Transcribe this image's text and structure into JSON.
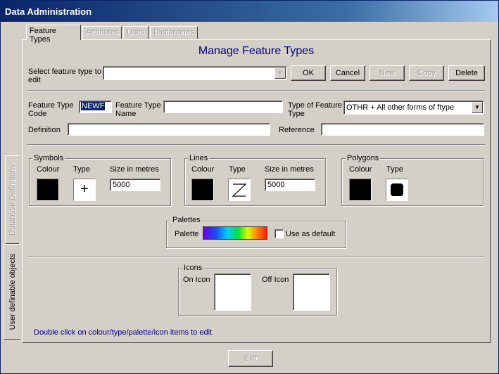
{
  "window": {
    "title": "Data Administration"
  },
  "tabs": [
    {
      "label": "Feature Types",
      "active": true
    },
    {
      "label": "Attributes",
      "active": false
    },
    {
      "label": "Units",
      "active": false
    },
    {
      "label": "Dictionaries",
      "active": false
    }
  ],
  "side_tabs": [
    {
      "label": "Database Definitions",
      "active": false
    },
    {
      "label": "User definable objects",
      "active": true
    }
  ],
  "heading": "Manage Feature Types",
  "select": {
    "label": "Select feature type to edit",
    "value": ""
  },
  "buttons": {
    "ok": "OK",
    "cancel": "Cancel",
    "new": "New",
    "copy": "Copy",
    "delete": "Delete",
    "exit": "Exit"
  },
  "form": {
    "code_label": "Feature Type Code",
    "code_value": "NEWF",
    "name_label": "Feature Type Name",
    "name_value": "",
    "type_label": "Type of Feature Type",
    "type_value": "OTHR + All other forms of ftype",
    "definition_label": "Definition",
    "definition_value": "",
    "reference_label": "Reference",
    "reference_value": ""
  },
  "symbols": {
    "title": "Symbols",
    "colour_label": "Colour",
    "type_label": "Type",
    "size_label": "Size in metres",
    "size_value": "5000",
    "colour": "#000000"
  },
  "lines": {
    "title": "Lines",
    "colour_label": "Colour",
    "type_label": "Type",
    "size_label": "Size in metres",
    "size_value": "5000",
    "colour": "#000000"
  },
  "polygons": {
    "title": "Polygons",
    "colour_label": "Colour",
    "type_label": "Type",
    "colour": "#000000"
  },
  "palettes": {
    "title": "Palettes",
    "palette_label": "Palette",
    "default_label": "Use as default",
    "default_checked": false
  },
  "icons": {
    "title": "Icons",
    "on_label": "On Icon",
    "off_label": "Off Icon"
  },
  "hint": "Double click on colour/type/palette/icon items to edit",
  "colors": {
    "heading": "#000080",
    "hint": "#000080",
    "selection": "#0a246a"
  }
}
